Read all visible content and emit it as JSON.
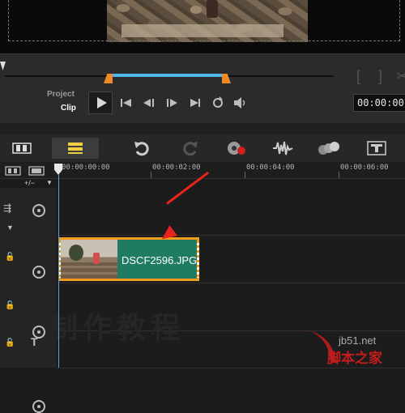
{
  "transport": {
    "project_label": "Project",
    "clip_label": "Clip",
    "timecode": "00:00:00",
    "bracket_in": "[",
    "bracket_out": "]"
  },
  "toolbar": {
    "buttons": [
      "storyboard-view-icon",
      "timeline-view-icon",
      "undo-icon",
      "redo-icon",
      "record-capture-icon",
      "sound-mixer-icon",
      "auto-music-icon",
      "title-icon"
    ]
  },
  "ruler": {
    "ticks": [
      "00:00:00:00",
      "00:00:02:00",
      "00:00:04:00",
      "00:00:06:00"
    ]
  },
  "tracks": {
    "add_remove_label": "+/−"
  },
  "clip": {
    "name": "DSCF2596.JPG"
  },
  "watermark": {
    "site": "jb51.net",
    "brand": "脚本之家"
  },
  "colors": {
    "accent": "#51b7ee",
    "marker": "#ef8a24",
    "clip_fill": "#1f7c62",
    "clip_border": "#f29b1a",
    "annotation": "#e8231d"
  }
}
